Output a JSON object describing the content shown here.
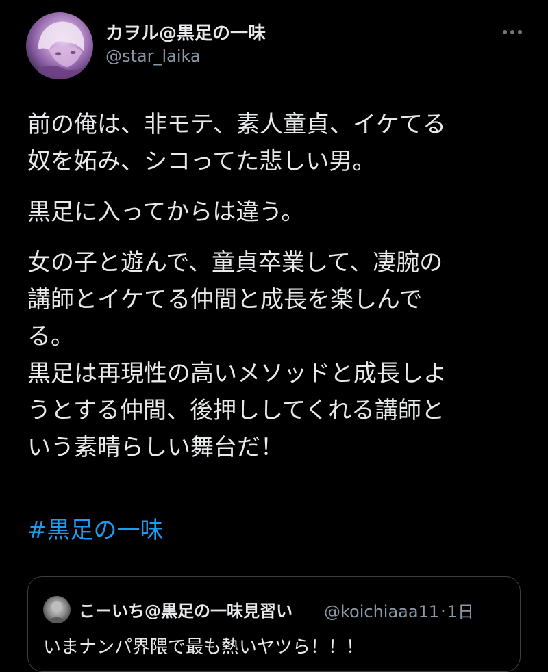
{
  "tweet": {
    "author": {
      "display_name": "カヲル@黒足の一味",
      "handle": "@star_laika",
      "avatar_icon": "avatar-image"
    },
    "more_icon": "more-horizontal-icon",
    "paragraphs": [
      [
        "前の俺は、非モテ、素人童貞、イケてる",
        "奴を妬み、シコってた悲しい男。"
      ],
      [
        "黒足に入ってからは違う。"
      ],
      [
        "女の子と遊んで、童貞卒業して、凄腕の",
        "講師とイケてる仲間と成長を楽しんで",
        "る。",
        "黒足は再現性の高いメソッドと成長しよ",
        "うとする仲間、後押ししてくれる講師と",
        "いう素晴らしい舞台だ！"
      ]
    ],
    "hashtag": "#黒足の一味",
    "hashtag_color": "#1d9bf0",
    "quote": {
      "display_name": "こーいち@黒足の一味見習い",
      "handle": "@koichiaaa11",
      "separator": "·",
      "time": "1日",
      "text": "いまナンパ界隈で最も熱いヤツら！！！"
    }
  },
  "colors": {
    "background": "#000000",
    "text_primary": "#e7e9ea",
    "text_secondary": "#8b98a5",
    "border": "#3a3f44"
  }
}
